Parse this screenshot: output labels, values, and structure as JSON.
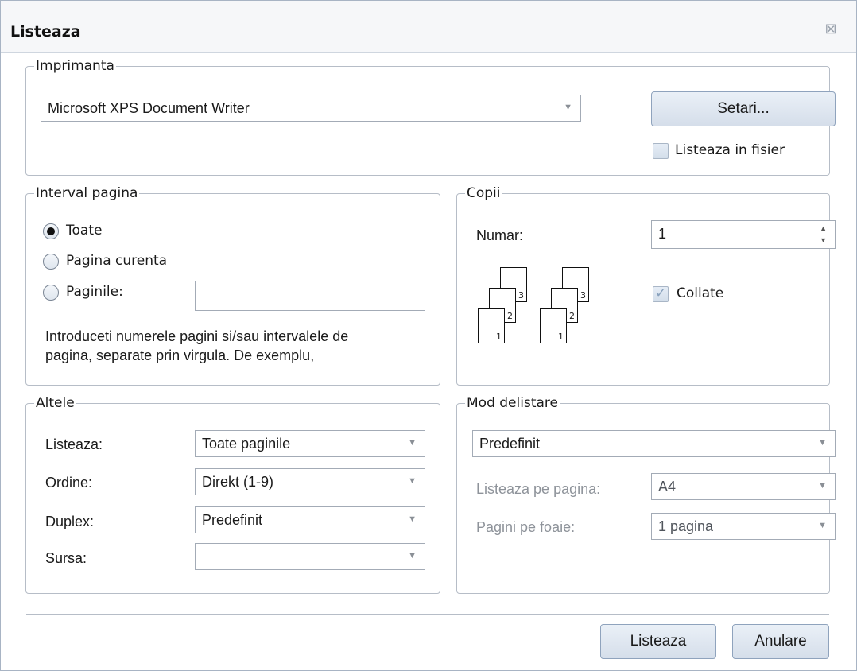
{
  "dialog": {
    "title": "Listeaza",
    "close_icon": "close-icon"
  },
  "printer": {
    "legend": "Imprimanta",
    "selected": "Microsoft XPS Document Writer",
    "settings_label": "Setari...",
    "print_to_file_label": "Listeaza in fisier",
    "print_to_file_checked": false
  },
  "page_range": {
    "legend": "Interval pagina",
    "options": [
      "Toate",
      "Pagina curenta",
      "Paginile:"
    ],
    "selected_index": 0,
    "pages_value": "",
    "hint_line1": "Introduceti numerele pagini si/sau intervalele de",
    "hint_line2": "pagina, separate prin virgula. De exemplu,"
  },
  "copies": {
    "legend": "Copii",
    "count_label": "Numar:",
    "count_value": "1",
    "collate_label": "Collate",
    "collate_checked": true,
    "page_numbers": [
      "1",
      "2",
      "3"
    ]
  },
  "other": {
    "legend": "Altele",
    "print_label": "Listeaza:",
    "print_value": "Toate paginile",
    "order_label": "Ordine:",
    "order_value": "Direkt (1-9)",
    "duplex_label": "Duplex:",
    "duplex_value": "Predefinit",
    "source_label": "Sursa:",
    "source_value": ""
  },
  "print_mode": {
    "legend": "Mod delistare",
    "mode_value": "Predefinit",
    "paper_label": "Listeaza pe pagina:",
    "paper_value": "A4",
    "pages_per_sheet_label": "Pagini pe foaie:",
    "pages_per_sheet_value": "1 pagina"
  },
  "footer": {
    "print_button": "Listeaza",
    "cancel_button": "Anulare"
  }
}
